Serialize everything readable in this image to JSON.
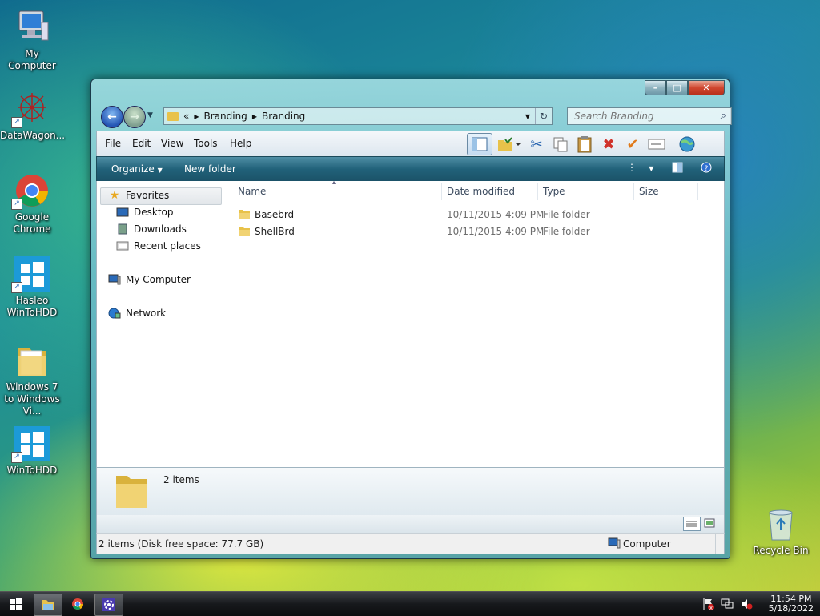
{
  "desktop": {
    "icons": [
      {
        "label": "My Computer"
      },
      {
        "label": "DataWagon..."
      },
      {
        "label": "Google Chrome"
      },
      {
        "label": "Hasleo WinToHDD"
      },
      {
        "label": "Windows 7 to Windows Vi..."
      },
      {
        "label": "WinToHDD"
      },
      {
        "label": "Recycle Bin"
      }
    ]
  },
  "window": {
    "address": {
      "overflow": "«",
      "crumbs": [
        "Branding",
        "Branding"
      ]
    },
    "search_placeholder": "Search Branding",
    "menu": [
      "File",
      "Edit",
      "View",
      "Tools",
      "Help"
    ],
    "commands": {
      "organize": "Organize",
      "new_folder": "New folder"
    },
    "nav_pane": {
      "favorites": "Favorites",
      "favorites_items": [
        "Desktop",
        "Downloads",
        "Recent places"
      ],
      "computer": "My Computer",
      "network": "Network"
    },
    "columns": [
      "Name",
      "Date modified",
      "Type",
      "Size"
    ],
    "files": [
      {
        "name": "Basebrd",
        "date": "10/11/2015 4:09 PM",
        "type": "File folder",
        "size": ""
      },
      {
        "name": "ShellBrd",
        "date": "10/11/2015 4:09 PM",
        "type": "File folder",
        "size": ""
      }
    ],
    "details_text": "2 items",
    "status": {
      "left": "2 items (Disk free space: 77.7 GB)",
      "right": "Computer"
    }
  },
  "taskbar": {
    "time": "11:54 PM",
    "date": "5/18/2022"
  },
  "colors": {
    "folder": "#e8c24a",
    "cmdbar": "#21627a",
    "close_button": "#d0472f"
  }
}
